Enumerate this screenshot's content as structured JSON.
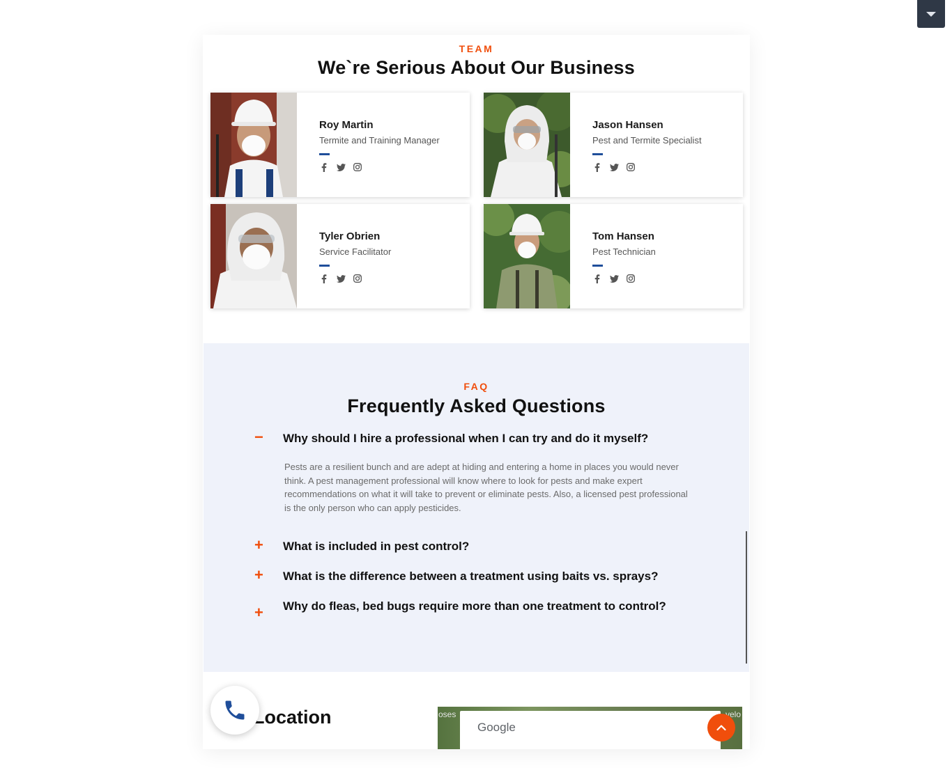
{
  "team": {
    "eyebrow": "TEAM",
    "heading": "We`re Serious About Our Business",
    "members": [
      {
        "name": "Roy Martin",
        "role": "Termite and Training Manager"
      },
      {
        "name": "Jason Hansen",
        "role": "Pest and Termite Specialist"
      },
      {
        "name": "Tyler Obrien",
        "role": "Service Facilitator"
      },
      {
        "name": "Tom Hansen",
        "role": "Pest Technician"
      }
    ],
    "social_icons": [
      "facebook-icon",
      "twitter-icon",
      "instagram-icon"
    ]
  },
  "faq": {
    "eyebrow": "FAQ",
    "heading": "Frequently Asked Questions",
    "items": [
      {
        "sign": "−",
        "question": "Why should I hire a professional when I can try and do it myself?",
        "answer": "Pests are a resilient bunch and are adept at hiding and entering a home in places you would never think. A pest management professional will know where to look for pests and make expert recommendations on what it will take to prevent or eliminate pests. Also, a licensed pest professional is the only person who can apply pesticides."
      },
      {
        "sign": "+",
        "question": "What is included in pest control?"
      },
      {
        "sign": "+",
        "question": "What is the difference between a treatment using baits vs. sprays?"
      },
      {
        "sign": "+",
        "question": "Why do fleas, bed bugs require more than one treatment to control?"
      }
    ]
  },
  "location": {
    "title": "Location",
    "map_brand": "Google",
    "map_left_text": "oses",
    "map_right_text": "velo"
  },
  "colors": {
    "accent": "#f04e0c",
    "bar_blue": "#1f4e9a",
    "faq_bg": "#eff2fa",
    "toggle_bg": "#2f3846"
  }
}
